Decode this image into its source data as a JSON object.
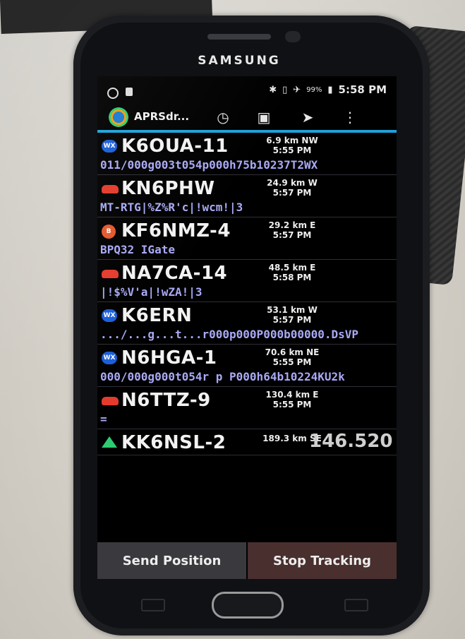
{
  "phone": {
    "brand": "SAMSUNG"
  },
  "statusbar": {
    "icons": [
      "bluetooth-icon",
      "vibrate-icon",
      "airplane-icon"
    ],
    "battery": "99%",
    "time": "5:58 PM"
  },
  "actionbar": {
    "title": "APRSdr...",
    "icons": [
      "history-clock-icon",
      "map-icon",
      "send-icon",
      "overflow-menu-icon"
    ]
  },
  "stations": [
    {
      "symbol": "wx",
      "symbol_label": "WX",
      "callsign": "K6OUA-11",
      "distance": "6.9 km NW",
      "time": "5:55 PM",
      "message": "011/000g003t054p000h75b10237T2WX"
    },
    {
      "symbol": "car",
      "symbol_label": "",
      "callsign": "KN6PHW",
      "distance": "24.9 km W",
      "time": "5:57 PM",
      "message": "MT-RTG|%Z%R'c|!wcm!|3"
    },
    {
      "symbol": "b",
      "symbol_label": "B",
      "callsign": "KF6NMZ-4",
      "distance": "29.2 km E",
      "time": "5:57 PM",
      "message": "BPQ32 IGate"
    },
    {
      "symbol": "car",
      "symbol_label": "",
      "callsign": "NA7CA-14",
      "distance": "48.5 km E",
      "time": "5:58 PM",
      "message": "|!$%V'a|!wZA!|3"
    },
    {
      "symbol": "wx",
      "symbol_label": "WX",
      "callsign": "K6ERN",
      "distance": "53.1 km W",
      "time": "5:57 PM",
      "message": ".../...g...t...r000p000P000b00000.DsVP"
    },
    {
      "symbol": "wx",
      "symbol_label": "WX",
      "callsign": "N6HGA-1",
      "distance": "70.6 km NE",
      "time": "5:55 PM",
      "message": "000/000g000t054r p P000h64b10224KU2k"
    },
    {
      "symbol": "car",
      "symbol_label": "",
      "callsign": "N6TTZ-9",
      "distance": "130.4 km E",
      "time": "5:55 PM",
      "message": "="
    }
  ],
  "partial_station": {
    "callsign": "KK6NSL-2",
    "distance": "189.3 km SE",
    "frequency": "146.520"
  },
  "bottom_buttons": {
    "send": "Send Position",
    "stop": "Stop Tracking"
  }
}
